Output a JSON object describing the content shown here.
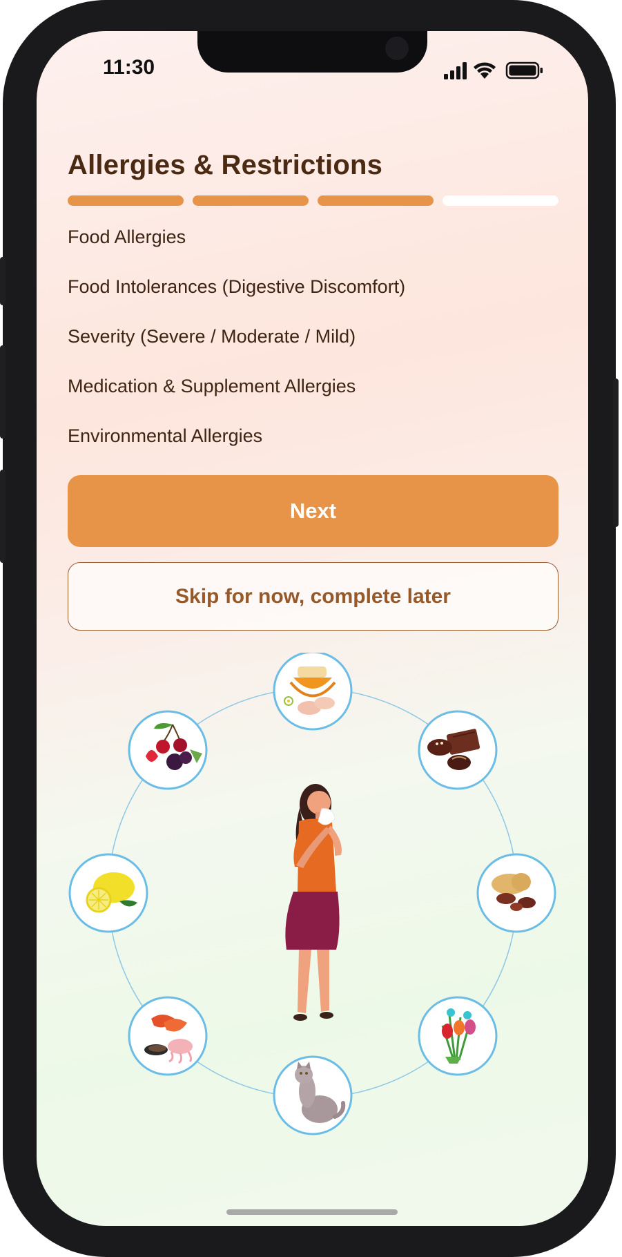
{
  "status_bar": {
    "time": "11:30"
  },
  "page": {
    "title": "Allergies & Restrictions"
  },
  "progress": {
    "steps_total": 4,
    "steps_completed": 3,
    "active_color": "#e89448",
    "inactive_color": "#ffffff"
  },
  "sections": [
    "Food Allergies",
    "Food Intolerances (Digestive Discomfort)",
    "Severity (Severe / Moderate / Mild)",
    "Medication & Supplement Allergies",
    "Environmental Allergies"
  ],
  "actions": {
    "next_label": "Next",
    "skip_label": "Skip for now, complete later"
  },
  "illustration": {
    "center_figure": "woman-sneezing",
    "icons": [
      "honey-and-eggs-icon",
      "chocolate-icon",
      "peanuts-icon",
      "flowers-icon",
      "cat-icon",
      "seafood-icon",
      "lemon-icon",
      "berries-icon"
    ]
  },
  "colors": {
    "accent": "#e89448",
    "title_text": "#4a2a12",
    "body_text": "#3f2414",
    "skip_text": "#96592a",
    "icon_ring": "#6bbde6"
  }
}
